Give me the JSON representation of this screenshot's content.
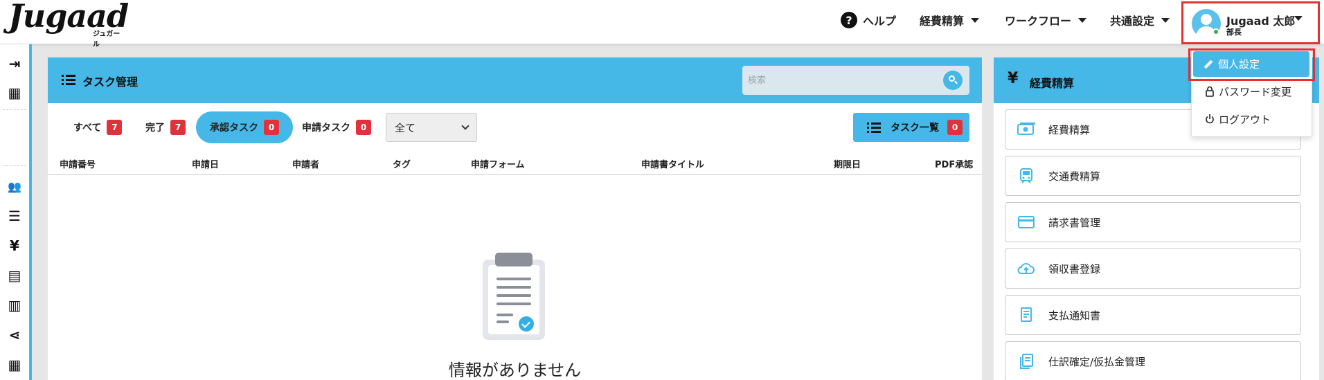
{
  "header": {
    "logo_text": "Jugaad",
    "logo_sub": "ジュガール",
    "help_icon": "?",
    "help_label": "ヘルプ",
    "nav": [
      "経費精算",
      "ワークフロー",
      "共通設定"
    ],
    "user": {
      "name": "Jugaad 太郎",
      "role": "部長"
    }
  },
  "user_menu": {
    "items": [
      "個人設定",
      "パスワード変更",
      "ログアウト"
    ],
    "active_index": 0
  },
  "sidebar": {
    "icons": [
      "collapse-icon",
      "building-icon",
      "users-icon",
      "list-icon",
      "yen-icon",
      "receipt-icon",
      "document-icon",
      "share-icon",
      "grid-icon"
    ],
    "glyphs": [
      "⇥",
      "▦",
      "👥",
      "☰",
      "¥",
      "▤",
      "▥",
      "⋖",
      "▦"
    ]
  },
  "task_panel": {
    "title": "タスク管理",
    "search_placeholder": "検索",
    "filters": [
      {
        "label": "すべて",
        "count": "7"
      },
      {
        "label": "完了",
        "count": "7"
      },
      {
        "label": "承認タスク",
        "count": "0"
      },
      {
        "label": "申請タスク",
        "count": "0"
      }
    ],
    "active_filter": 2,
    "select_value": "全て",
    "task_list_button": {
      "label": "タスク一覧",
      "count": "0"
    },
    "columns": [
      "申請番号",
      "申請日",
      "申請者",
      "タグ",
      "申請フォーム",
      "申請書タイトル",
      "期限日",
      "PDF承認"
    ],
    "empty_text": "情報がありません"
  },
  "expense_panel": {
    "icon": "¥",
    "title": "経費精算",
    "items": [
      "経費精算",
      "交通費精算",
      "請求書管理",
      "領収書登録",
      "支払通知書",
      "仕訳確定/仮払金管理"
    ]
  },
  "colors": {
    "accent": "#45b8e8",
    "badge": "#e0323c",
    "highlight": "#e53030"
  }
}
